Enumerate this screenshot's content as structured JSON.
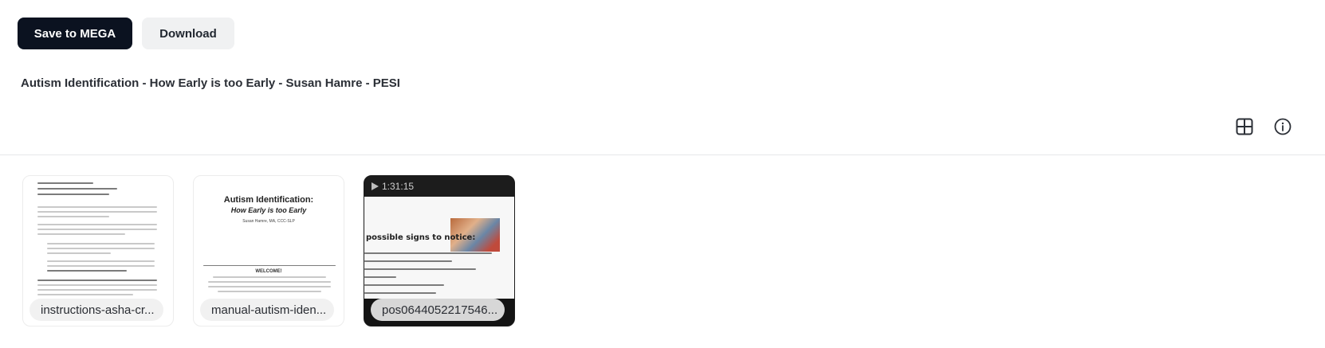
{
  "toolbar": {
    "save_label": "Save to MEGA",
    "download_label": "Download"
  },
  "folder": {
    "title": "Autism Identification - How Early is too Early - Susan Hamre - PESI"
  },
  "view_controls": {
    "icons": [
      "grid-view-icon",
      "info-icon"
    ]
  },
  "files": [
    {
      "name": "instructions-asha-cr...",
      "kind": "document"
    },
    {
      "name": "manual-autism-iden...",
      "kind": "document",
      "preview": {
        "title": "Autism Identification:",
        "subtitle": "How Early is too Early",
        "author": "Susan Hamre, MA, CCC-SLP",
        "welcome": "WELCOME!"
      }
    },
    {
      "name": "pos0644052217546...",
      "kind": "video",
      "duration": "1:31:15",
      "preview": {
        "heading": "possible signs to notice:"
      }
    }
  ],
  "colors": {
    "primary_button": "#0b1220",
    "secondary_button": "#f0f1f2"
  }
}
